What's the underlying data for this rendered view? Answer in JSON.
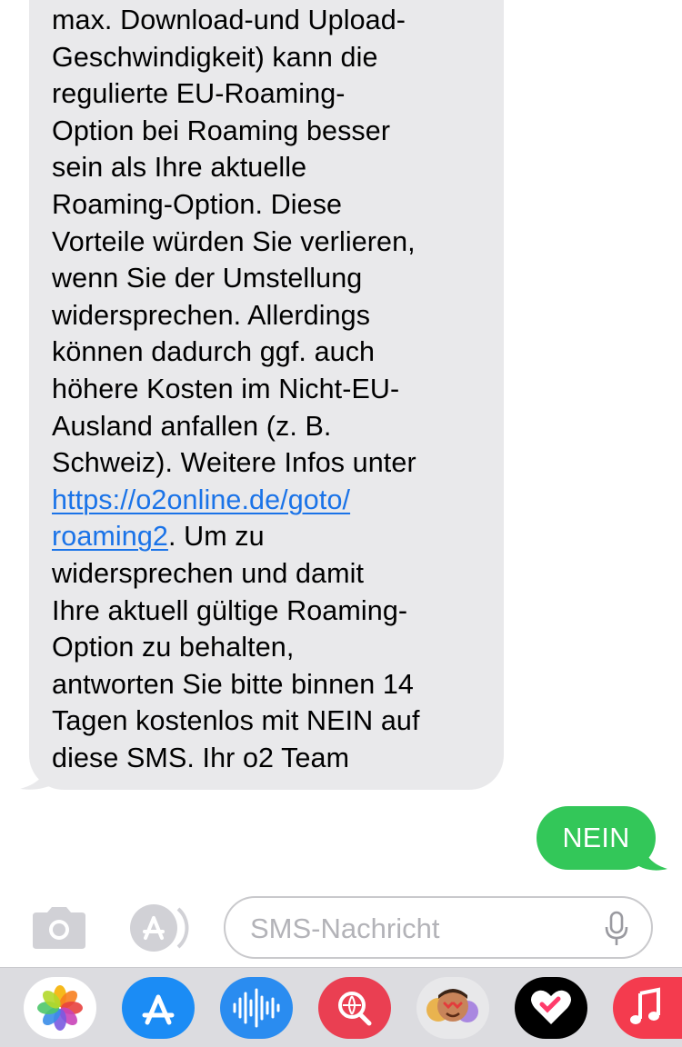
{
  "incoming_message": {
    "lines": [
      {
        "text": "max. Download-und Upload-"
      },
      {
        "text": "Geschwindigkeit) kann die"
      },
      {
        "text": "regulierte EU-Roaming-"
      },
      {
        "text": "Option bei Roaming besser"
      },
      {
        "text": "sein als Ihre aktuelle"
      },
      {
        "text": "Roaming-Option. Diese"
      },
      {
        "text": "Vorteile würden Sie verlieren,"
      },
      {
        "text": "wenn Sie der Umstellung"
      },
      {
        "text": "widersprechen. Allerdings"
      },
      {
        "text": "können dadurch ggf. auch"
      },
      {
        "text": "höhere Kosten im Nicht-EU-"
      },
      {
        "text": "Ausland anfallen (z. B."
      },
      {
        "text": "Schweiz). Weitere Infos unter"
      }
    ],
    "link_line_1": "https://o2online.de/goto/",
    "link_line_2": "roaming2",
    "after_link": ". Um zu",
    "lines_end": [
      {
        "text": "widersprechen und damit"
      },
      {
        "text": "Ihre aktuell gültige Roaming-"
      },
      {
        "text": "Option zu behalten,"
      },
      {
        "text": "antworten Sie bitte binnen 14"
      },
      {
        "text": "Tagen kostenlos mit NEIN auf"
      },
      {
        "text": "diese SMS. Ihr o2 Team"
      }
    ]
  },
  "outgoing_message": {
    "text": "NEIN"
  },
  "input_bar": {
    "placeholder": "SMS-Nachricht",
    "camera_icon": "camera-icon",
    "appstore_icon": "app-store-icon",
    "mic_icon": "microphone-icon"
  },
  "app_drawer": {
    "apps": [
      {
        "name": "photos-app-icon"
      },
      {
        "name": "app-store-app-icon"
      },
      {
        "name": "audio-message-app-icon"
      },
      {
        "name": "images-search-app-icon"
      },
      {
        "name": "memoji-app-icon"
      },
      {
        "name": "digital-touch-app-icon"
      },
      {
        "name": "music-app-icon"
      }
    ]
  },
  "colors": {
    "incoming_bubble": "#e9e9eb",
    "outgoing_bubble": "#33c759",
    "link": "#1a73e8",
    "placeholder": "#b3b3b8",
    "drawer_bg": "#dcdce0"
  }
}
